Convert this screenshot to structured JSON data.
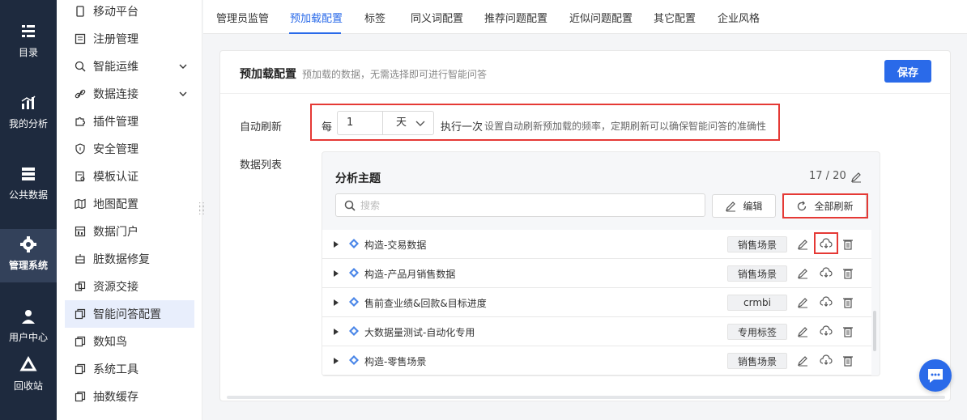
{
  "left_nav": [
    {
      "label": "目录",
      "icon": "list-icon"
    },
    {
      "label": "我的分析",
      "icon": "bar-chart-icon"
    },
    {
      "label": "公共数据",
      "icon": "database-icon"
    },
    {
      "label": "管理系统",
      "icon": "gear-icon",
      "active": true
    },
    {
      "label": "用户中心",
      "icon": "user-icon"
    },
    {
      "label": "回收站",
      "icon": "recycle-icon"
    }
  ],
  "sidebar": {
    "items": [
      {
        "label": "移动平台"
      },
      {
        "label": "注册管理"
      },
      {
        "label": "智能运维"
      },
      {
        "label": "数据连接"
      },
      {
        "label": "插件管理"
      },
      {
        "label": "安全管理"
      },
      {
        "label": "模板认证"
      },
      {
        "label": "地图配置"
      },
      {
        "label": "数据门户"
      },
      {
        "label": "脏数据修复"
      },
      {
        "label": "资源交接"
      },
      {
        "label": "智能问答配置"
      },
      {
        "label": "数知鸟"
      },
      {
        "label": "系统工具"
      },
      {
        "label": "抽数缓存"
      }
    ]
  },
  "tabs": [
    "管理员监管",
    "预加载配置",
    "标签",
    "同义词配置",
    "推荐问题配置",
    "近似问题配置",
    "其它配置",
    "企业风格"
  ],
  "card": {
    "title": "预加载配置",
    "subtitle": "预加载的数据，无需选择即可进行智能问答",
    "save_label": "保存",
    "auto_refresh_label": "自动刷新",
    "every": "每",
    "interval_value": "1",
    "interval_unit": "天",
    "exec_label": "执行一次",
    "exec_desc": "设置自动刷新预加载的频率，定期刷新可以确保智能问答的准确性",
    "data_list_label": "数据列表"
  },
  "panel": {
    "title": "分析主题",
    "count": "17 / 20",
    "search_placeholder": "搜索",
    "edit_label": "编辑",
    "refresh_all_label": "全部刷新",
    "rows": [
      {
        "name": "构造-交易数据",
        "tag": "销售场景"
      },
      {
        "name": "构造-产品月销售数据",
        "tag": "销售场景"
      },
      {
        "name": "售前查业绩&回款&目标进度",
        "tag": "crmbi"
      },
      {
        "name": "大数据量测试-自动化专用",
        "tag": "专用标签"
      },
      {
        "name": "构造-零售场景",
        "tag": "销售场景"
      }
    ]
  },
  "colors": {
    "accent": "#2a6ae9",
    "nav_bg": "#1e2a3e",
    "highlight": "#e53935"
  }
}
